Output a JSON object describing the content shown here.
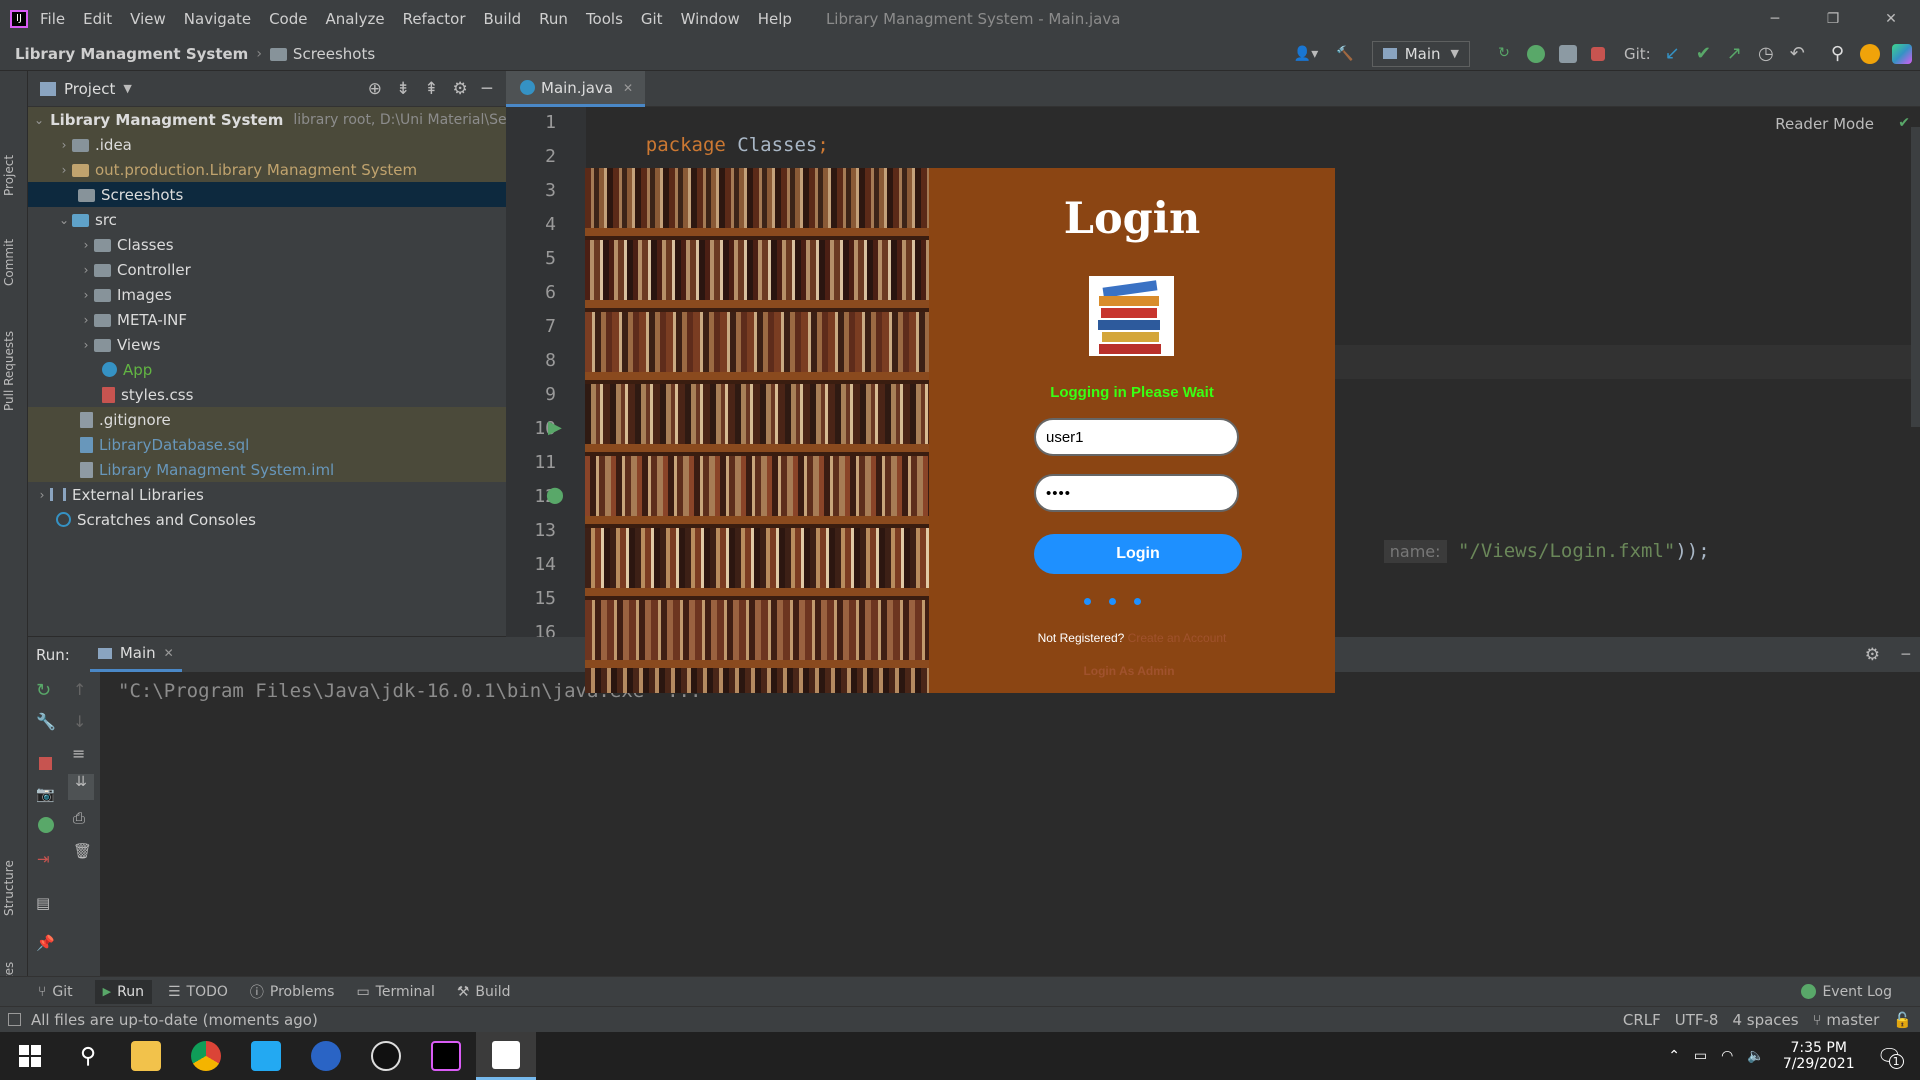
{
  "window": {
    "title": "Library Managment System - Main.java",
    "menu": [
      "File",
      "Edit",
      "View",
      "Navigate",
      "Code",
      "Analyze",
      "Refactor",
      "Build",
      "Run",
      "Tools",
      "Git",
      "Window",
      "Help"
    ]
  },
  "navbar": {
    "breadcrumb_project": "Library Managment System",
    "breadcrumb_folder": "Screeshots",
    "run_config": "Main",
    "git_label": "Git:"
  },
  "left_strip": {
    "project": "Project",
    "commit": "Commit",
    "pull_requests": "Pull Requests",
    "structure": "Structure",
    "favorites": "Favorites"
  },
  "project_panel": {
    "header": "Project",
    "root_name": "Library Managment System",
    "root_suffix": "library root,  D:\\Uni Material\\Seme",
    "items": [
      {
        "label": "Library Managment System"
      },
      {
        "label": ".idea"
      },
      {
        "label": "out.production.Library Managment System"
      },
      {
        "label": "Screeshots"
      },
      {
        "label": "src"
      },
      {
        "label": "Classes"
      },
      {
        "label": "Controller"
      },
      {
        "label": "Images"
      },
      {
        "label": "META-INF"
      },
      {
        "label": "Views"
      },
      {
        "label": "App"
      },
      {
        "label": "styles.css"
      },
      {
        "label": ".gitignore"
      },
      {
        "label": "LibraryDatabase.sql"
      },
      {
        "label": "Library Managment System.iml"
      },
      {
        "label": "External Libraries"
      },
      {
        "label": "Scratches and Consoles"
      }
    ]
  },
  "editor": {
    "tab": "Main.java",
    "reader_mode": "Reader Mode",
    "line_numbers": [
      "1",
      "2",
      "3",
      "4",
      "5",
      "6",
      "7",
      "8",
      "9",
      "10",
      "11",
      "12",
      "13",
      "14",
      "15",
      "16"
    ],
    "code_keyword": "package",
    "code_package": "Classes",
    "code_semicolon": ";",
    "param_hint": "name:",
    "code_string": "\"/Views/Login.fxml\"",
    "code_tail": "));",
    "code_tail16": ");"
  },
  "run_panel": {
    "label": "Run:",
    "tab": "Main",
    "console": "\"C:\\Program Files\\Java\\jdk-16.0.1\\bin\\java.exe\" ..."
  },
  "login": {
    "title": "Login",
    "status": "Logging in Please Wait",
    "username_value": "user1",
    "password_value": "••••",
    "button": "Login",
    "not_registered": "Not Registered?",
    "create_account": "Create an Account",
    "login_admin": "Login As Admin",
    "colors": {
      "panel": "#8b4513",
      "status": "#39ff14",
      "button": "#1e90ff"
    }
  },
  "tool_windows": [
    "Git",
    "Run",
    "TODO",
    "Problems",
    "Terminal",
    "Build"
  ],
  "event_log": "Event Log",
  "status_bar": {
    "message": "All files are up-to-date (moments ago)",
    "line_sep": "CRLF",
    "encoding": "UTF-8",
    "indent": "4 spaces",
    "branch": "master"
  },
  "taskbar": {
    "time": "7:35 PM",
    "date": "7/29/2021",
    "notifications": "1"
  }
}
